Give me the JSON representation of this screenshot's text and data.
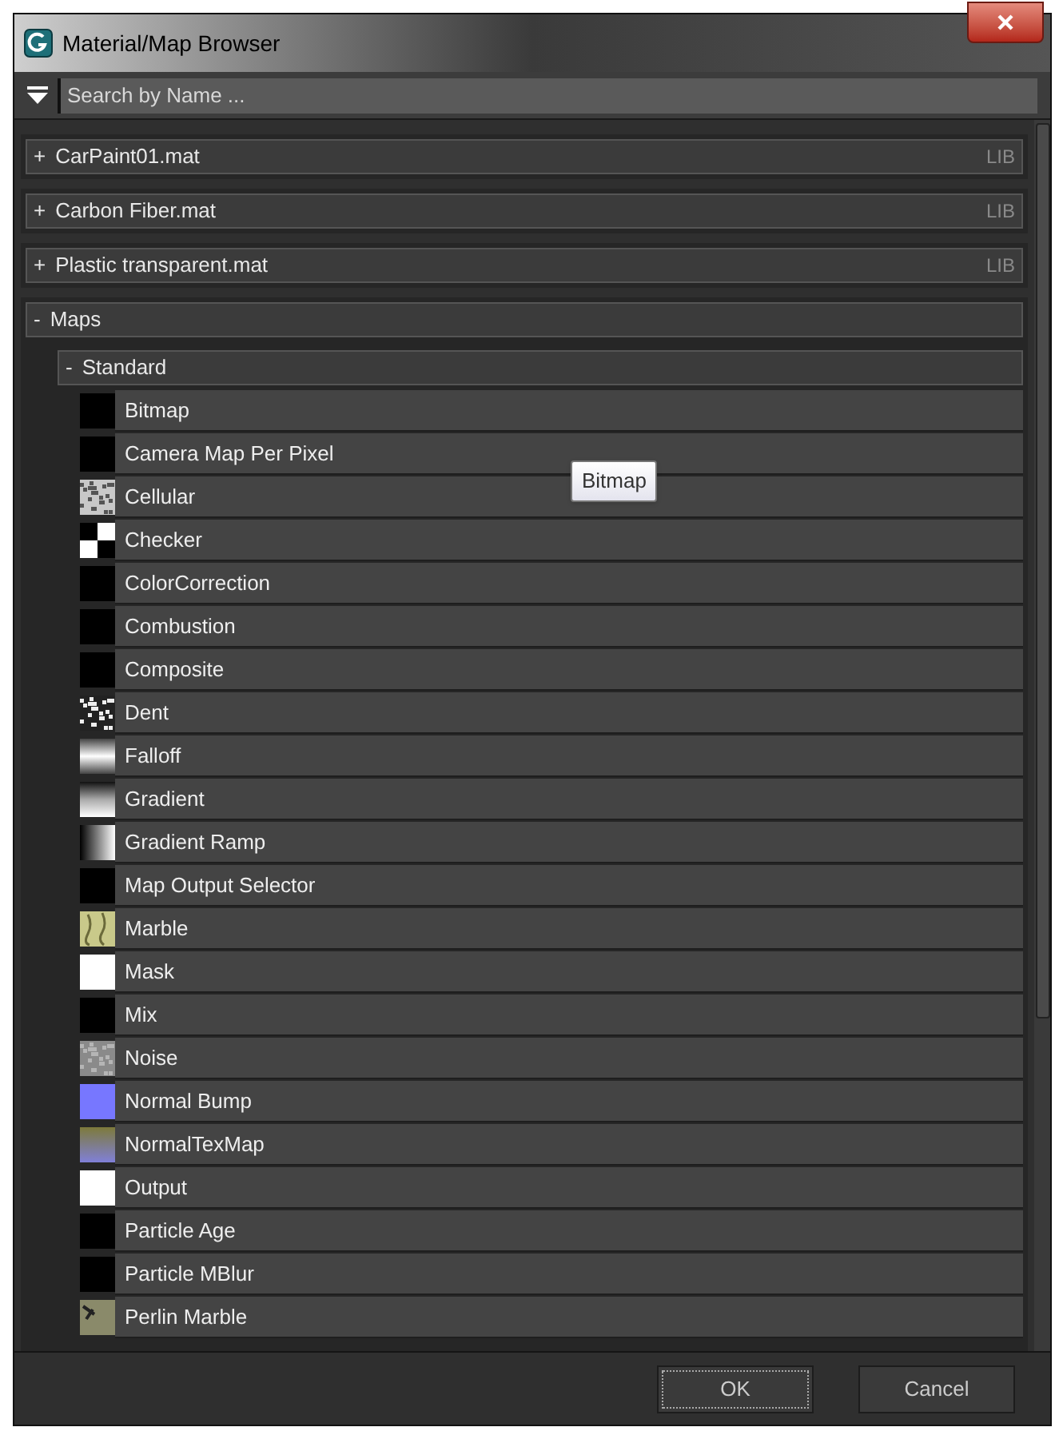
{
  "window": {
    "title": "Material/Map Browser"
  },
  "search": {
    "placeholder": "Search by Name ..."
  },
  "libraries": [
    {
      "label": "CarPaint01.mat",
      "sign": "+",
      "tag": "LIB"
    },
    {
      "label": "Carbon Fiber.mat",
      "sign": "+",
      "tag": "LIB"
    },
    {
      "label": "Plastic transparent.mat",
      "sign": "+",
      "tag": "LIB"
    }
  ],
  "maps": {
    "label": "Maps",
    "sign": "-",
    "group": {
      "label": "Standard",
      "sign": "-",
      "items": [
        {
          "label": "Bitmap",
          "kind": "black"
        },
        {
          "label": "Camera Map Per Pixel",
          "kind": "black"
        },
        {
          "label": "Cellular",
          "kind": "cellular"
        },
        {
          "label": "Checker",
          "kind": "checker"
        },
        {
          "label": "ColorCorrection",
          "kind": "black"
        },
        {
          "label": "Combustion",
          "kind": "black"
        },
        {
          "label": "Composite",
          "kind": "black"
        },
        {
          "label": "Dent",
          "kind": "dent"
        },
        {
          "label": "Falloff",
          "kind": "falloff"
        },
        {
          "label": "Gradient",
          "kind": "gradient"
        },
        {
          "label": "Gradient Ramp",
          "kind": "ramp"
        },
        {
          "label": "Map Output Selector",
          "kind": "black"
        },
        {
          "label": "Marble",
          "kind": "marble"
        },
        {
          "label": "Mask",
          "kind": "white"
        },
        {
          "label": "Mix",
          "kind": "black"
        },
        {
          "label": "Noise",
          "kind": "noise"
        },
        {
          "label": "Normal Bump",
          "kind": "normal_bump"
        },
        {
          "label": "NormalTexMap",
          "kind": "normal_tex"
        },
        {
          "label": "Output",
          "kind": "white"
        },
        {
          "label": "Particle Age",
          "kind": "black"
        },
        {
          "label": "Particle MBlur",
          "kind": "black"
        },
        {
          "label": "Perlin Marble",
          "kind": "perlin"
        }
      ]
    }
  },
  "tooltip": "Bitmap",
  "buttons": [
    {
      "label": "OK",
      "focused": true
    },
    {
      "label": "Cancel",
      "focused": false
    }
  ]
}
